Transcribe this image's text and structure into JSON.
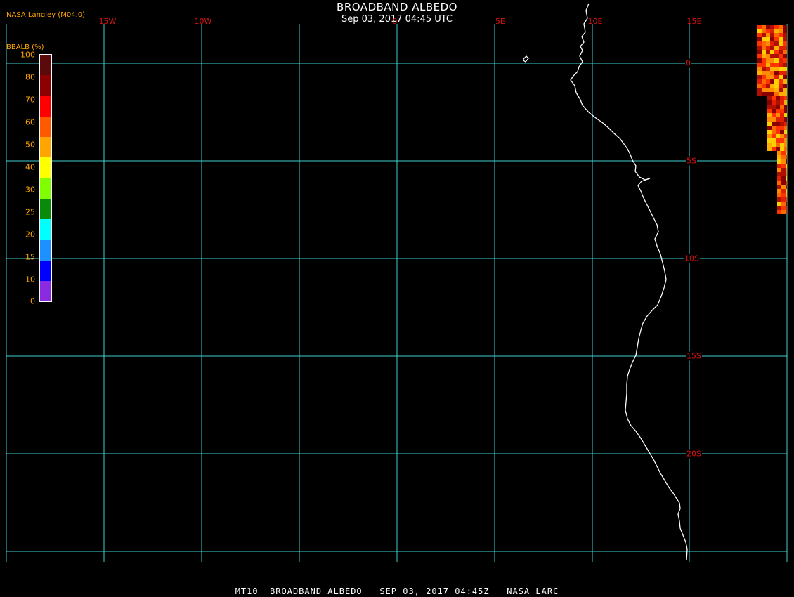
{
  "header": {
    "title": "BROADBAND ALBEDO",
    "subtitle": "Sep 03, 2017 04:45 UTC",
    "credit": "NASA Langley (M04.0)"
  },
  "map": {
    "lon_labels": [
      "15W",
      "10W",
      "0",
      "5E",
      "10E",
      "15E"
    ],
    "lat_labels": [
      "0",
      "5S",
      "10S",
      "15S",
      "20S"
    ],
    "grid_color": "#40d0d0",
    "label_color": "#d81010",
    "coastline_color": "#ffffff"
  },
  "legend": {
    "title": "BBALB (%)",
    "ticks": [
      "100",
      "80",
      "70",
      "60",
      "50",
      "40",
      "30",
      "25",
      "20",
      "15",
      "10",
      "0"
    ],
    "colors": [
      "#5a0a0a",
      "#8b0000",
      "#ff0000",
      "#ff5a00",
      "#ffa500",
      "#ffff00",
      "#7fff00",
      "#0a8a0a",
      "#00ffff",
      "#1e90ff",
      "#0000ff",
      "#8a2be2"
    ]
  },
  "footer": "MT10  BROADBAND ALBEDO   SEP 03, 2017 04:45Z   NASA LARC"
}
